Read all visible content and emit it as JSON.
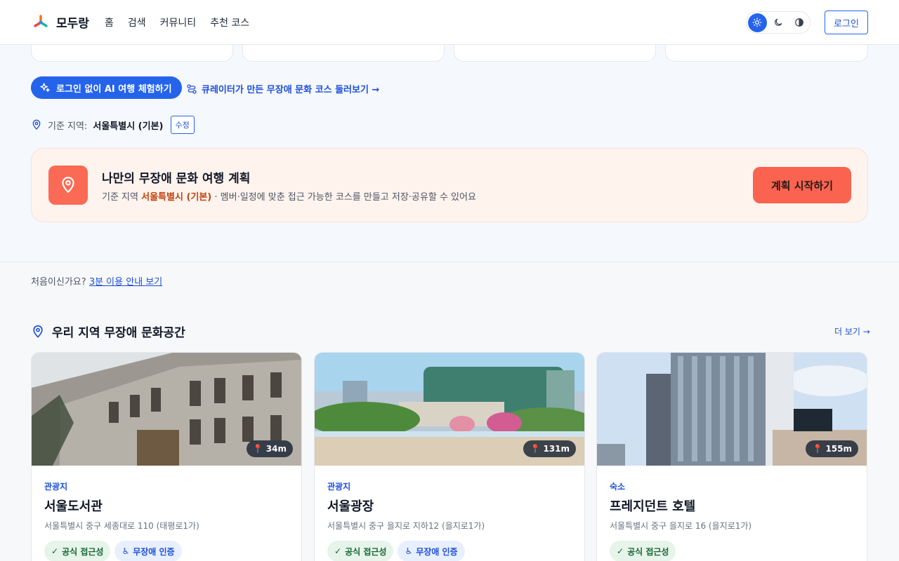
{
  "header": {
    "logo_text": "모두랑",
    "nav": [
      "홈",
      "검색",
      "커뮤니티",
      "추천 코스"
    ],
    "login_label": "로그인"
  },
  "hero": {
    "ai_button": "로그인 없이 AI 여행 체험하기",
    "curator_link": "큐레이터가 만든 무장애 문화 코스 둘러보기 →",
    "region_label": "기준 지역:",
    "region_value": "서울특별시 (기본)",
    "edit_label": "수정"
  },
  "plan": {
    "title": "나만의 무장애 문화 여행 계획",
    "desc_prefix": "기준 지역",
    "desc_region": "서울특별시 (기본)",
    "desc_suffix": "· 멤버·일정에 맞춘 접근 가능한 코스를 만들고 저장·공유할 수 있어요",
    "start_button": "계획 시작하기"
  },
  "guide": {
    "prefix": "처음이신가요?",
    "link": "3분 이용 안내 보기"
  },
  "section": {
    "title": "우리 지역 무장애 문화공간",
    "more": "더 보기 →"
  },
  "places": [
    {
      "category": "관광지",
      "name": "서울도서관",
      "address": "서울특별시 중구 세종대로 110 (태평로1가)",
      "distance": "34m",
      "badges": [
        "공식 접근성",
        "무장애 인증"
      ]
    },
    {
      "category": "관광지",
      "name": "서울광장",
      "address": "서울특별시 중구 을지로 지하12 (을지로1가)",
      "distance": "131m",
      "badges": [
        "공식 접근성",
        "무장애 인증"
      ]
    },
    {
      "category": "숙소",
      "name": "프레지던트 호텔",
      "address": "서울특별시 중구 을지로 16 (을지로1가)",
      "distance": "155m",
      "badges": [
        "공식 접근성"
      ]
    }
  ],
  "colors": {
    "primary": "#2563eb",
    "coral": "#fb6351",
    "badge_green": "#166534",
    "badge_blue": "#1d4ed8"
  }
}
